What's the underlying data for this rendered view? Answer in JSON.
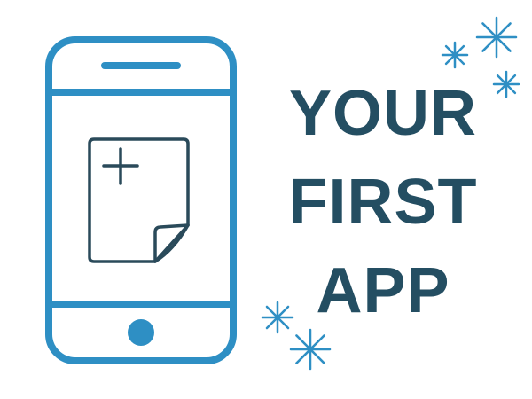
{
  "title": {
    "lines": [
      "YOUR",
      "FIRST",
      "APP"
    ]
  },
  "colors": {
    "phone_outline": "#2e8fc4",
    "document_stroke": "#2a4a5a",
    "title_text": "#244e62",
    "sparkle": "#2e8fc4",
    "background": "#ffffff"
  },
  "icons": {
    "phone": "smartphone-icon",
    "document": "new-document-icon",
    "plus": "plus-icon",
    "sparkle": "sparkle-icon"
  }
}
